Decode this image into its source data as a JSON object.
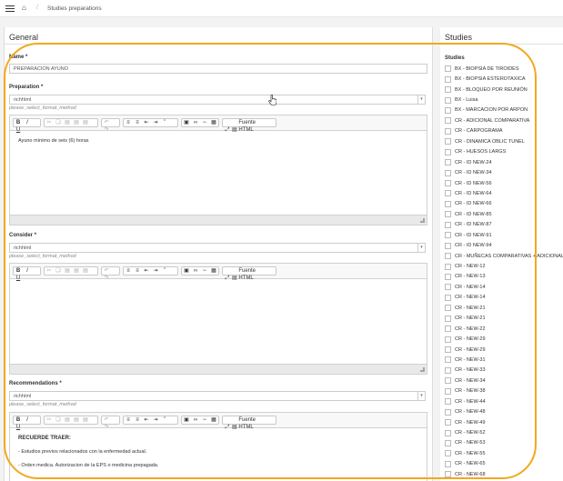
{
  "breadcrumb": {
    "current": "Studies preparations"
  },
  "general": {
    "title": "General",
    "name_label": "Name *",
    "name_value": "PREPARACION AYUNO",
    "preparation": {
      "label": "Preparation *",
      "format": "richhtml",
      "hint": "please_select_format_method",
      "content": [
        "Ayuno mínimo de seis (6) horas"
      ]
    },
    "consider": {
      "label": "Consider *",
      "format": "richhtml",
      "hint": "please_select_format_method",
      "content": []
    },
    "recommendations": {
      "label": "Recommendations *",
      "format": "richhtml",
      "hint": "please_select_format_method",
      "heading": "RECUERDE TRAER:",
      "content": [
        "- Estudios previos relacionados con la enfermedad actual.",
        "- Orden medica. Autorizacion de la EPS o medicina prepagada."
      ]
    },
    "toolbar": {
      "source_label": "Fuente HTML"
    }
  },
  "studies": {
    "title": "Studies",
    "label": "Studies",
    "items": [
      "BX - BIOPSIA DE TIROIDES",
      "BX - BIOPSIA ESTEROTAXICA",
      "BX - BLOQUEO POR REUNIÓN",
      "BX - Luisa",
      "BX - MARCACION POR ARPON",
      "CR - ADICIONAL COMPARATIVA",
      "CR - CARPOGRAMA",
      "CR - DINAMICA OBLIC TUNEL",
      "CR - HUESOS LARGS",
      "CR - ID NEW-24",
      "CR - ID NEW-34",
      "CR - ID NEW-56",
      "CR - ID NEW-64",
      "CR - ID NEW-66",
      "CR - ID NEW-85",
      "CR - ID NEW-87",
      "CR - ID NEW-91",
      "CR - ID NEW-94",
      "CR - MUÑECAS COMPARATIVAS + ADICIONAL",
      "CR - NEW-12",
      "CR - NEW-13",
      "CR - NEW-14",
      "CR - NEW-14",
      "CR - NEW-21",
      "CR - NEW-21",
      "CR - NEW-22",
      "CR - NEW-29",
      "CR - NEW-29",
      "CR - NEW-31",
      "CR - NEW-33",
      "CR - NEW-34",
      "CR - NEW-38",
      "CR - NEW-44",
      "CR - NEW-48",
      "CR - NEW-49",
      "CR - NEW-52",
      "CR - NEW-53",
      "CR - NEW-55",
      "CR - NEW-65",
      "CR - NEW-68"
    ]
  },
  "colors": {
    "highlight": "#f2a81d",
    "background": "#f3f3f3"
  },
  "icons": [
    "menu-icon",
    "home-icon",
    "cursor-hand-icon",
    "resize-handle-icon"
  ]
}
